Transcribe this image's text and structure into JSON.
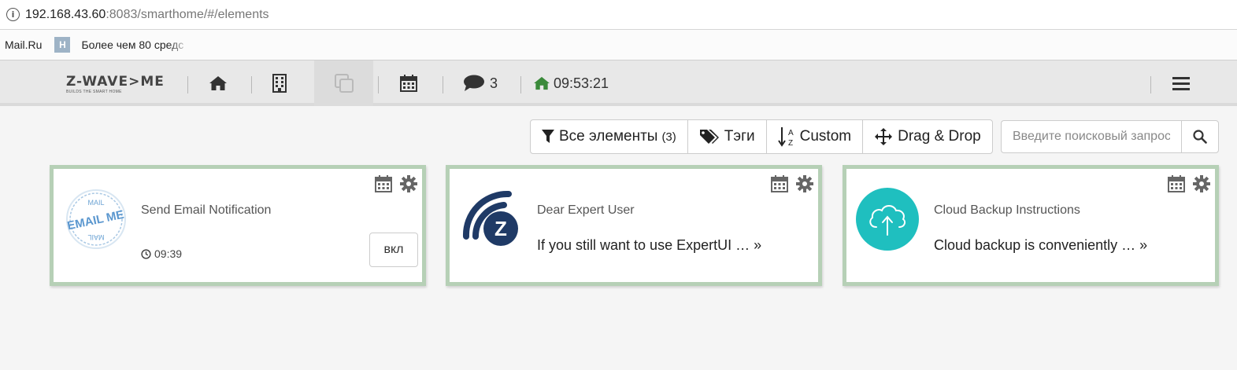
{
  "browser": {
    "url_host": "192.168.43.60",
    "url_rest": ":8083/smarthome/#/elements",
    "info_icon": "info-icon"
  },
  "bookmarks": [
    {
      "label": "Mail.Ru"
    },
    {
      "label": "Более чем 80 средс",
      "icon_letter": "H"
    }
  ],
  "navbar": {
    "logo_main": "Z-WAVE>ME",
    "logo_sub": "BUILDS THE SMART HOME",
    "notifications_count": "3",
    "clock": "09:53:21",
    "icons": [
      "home-icon",
      "building-icon",
      "copy-icon",
      "calendar-icon",
      "comment-icon",
      "home-clock-icon",
      "hamburger-menu-icon"
    ]
  },
  "toolbar": {
    "all_elements_label": "Все элементы",
    "all_elements_count": "(3)",
    "tags_label": "Тэги",
    "sort_label": "Custom",
    "sort_icon_text_a": "A",
    "sort_icon_text_z": "Z",
    "drag_label": "Drag & Drop",
    "search_placeholder": "Введите поисковый запрос"
  },
  "cards": [
    {
      "title": "Send Email Notification",
      "time": "09:39",
      "button": "вкл",
      "image": "email-me-stamp",
      "image_text_top": "MAIL",
      "image_text_mid": "EMAIL ME",
      "image_text_bot": "MAIL"
    },
    {
      "title": "Dear Expert User",
      "desc": "If you still want to use ExpertUI … »",
      "image": "z-wave-logo",
      "image_letter": "Z"
    },
    {
      "title": "Cloud Backup Instructions",
      "desc": "Cloud backup is conveniently … »",
      "image": "cloud-upload-icon"
    }
  ],
  "colors": {
    "card_border": "#b6d0b6",
    "clock_home_icon": "#3a8a3a",
    "zwave_blue": "#1f3a66",
    "cloud_teal": "#1fbfbf"
  }
}
